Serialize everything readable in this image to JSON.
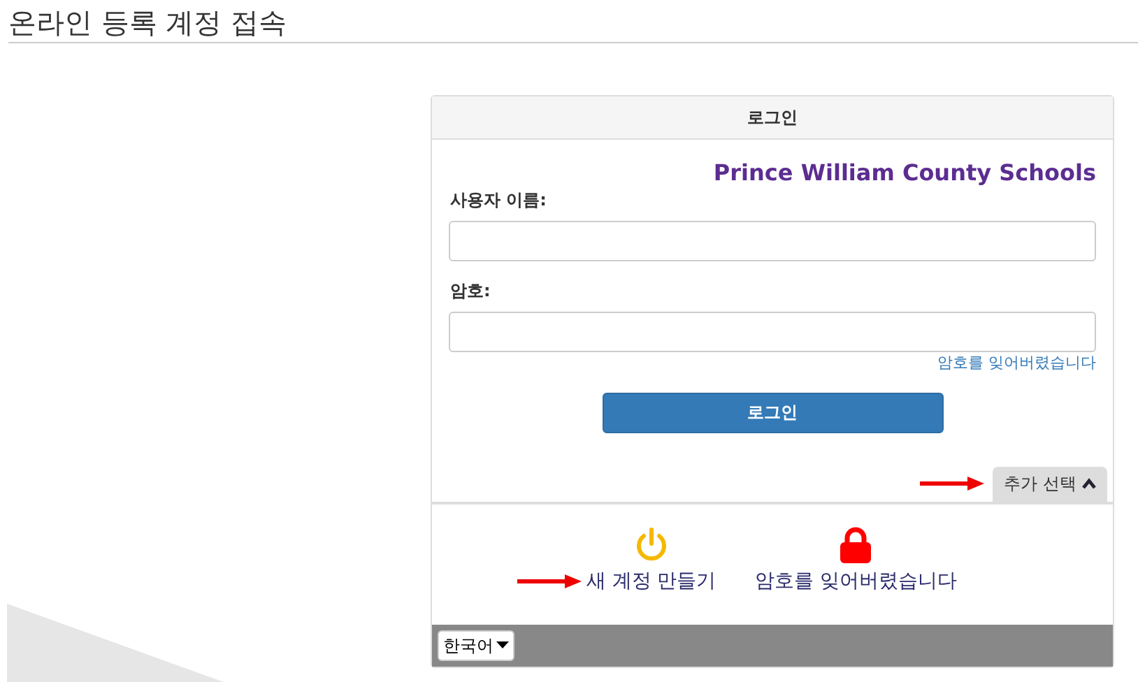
{
  "page_title": "온라인 등록 계정 접속",
  "login_panel": {
    "title": "로그인",
    "brand": "Prince William County Schools",
    "fields": [
      {
        "label": "사용자 이름:"
      },
      {
        "label": "암호:"
      }
    ],
    "forgot_link": "암호를 잊어버렸습니다",
    "submit_button": "로그인"
  },
  "more_options": {
    "label": "추가 선택",
    "expanded": true
  },
  "options": [
    {
      "kind": "power",
      "label": "새 계정 만들기"
    },
    {
      "kind": "lock",
      "label": "암호를 잊어버렸습니다"
    }
  ],
  "language": {
    "value": "한국어"
  }
}
